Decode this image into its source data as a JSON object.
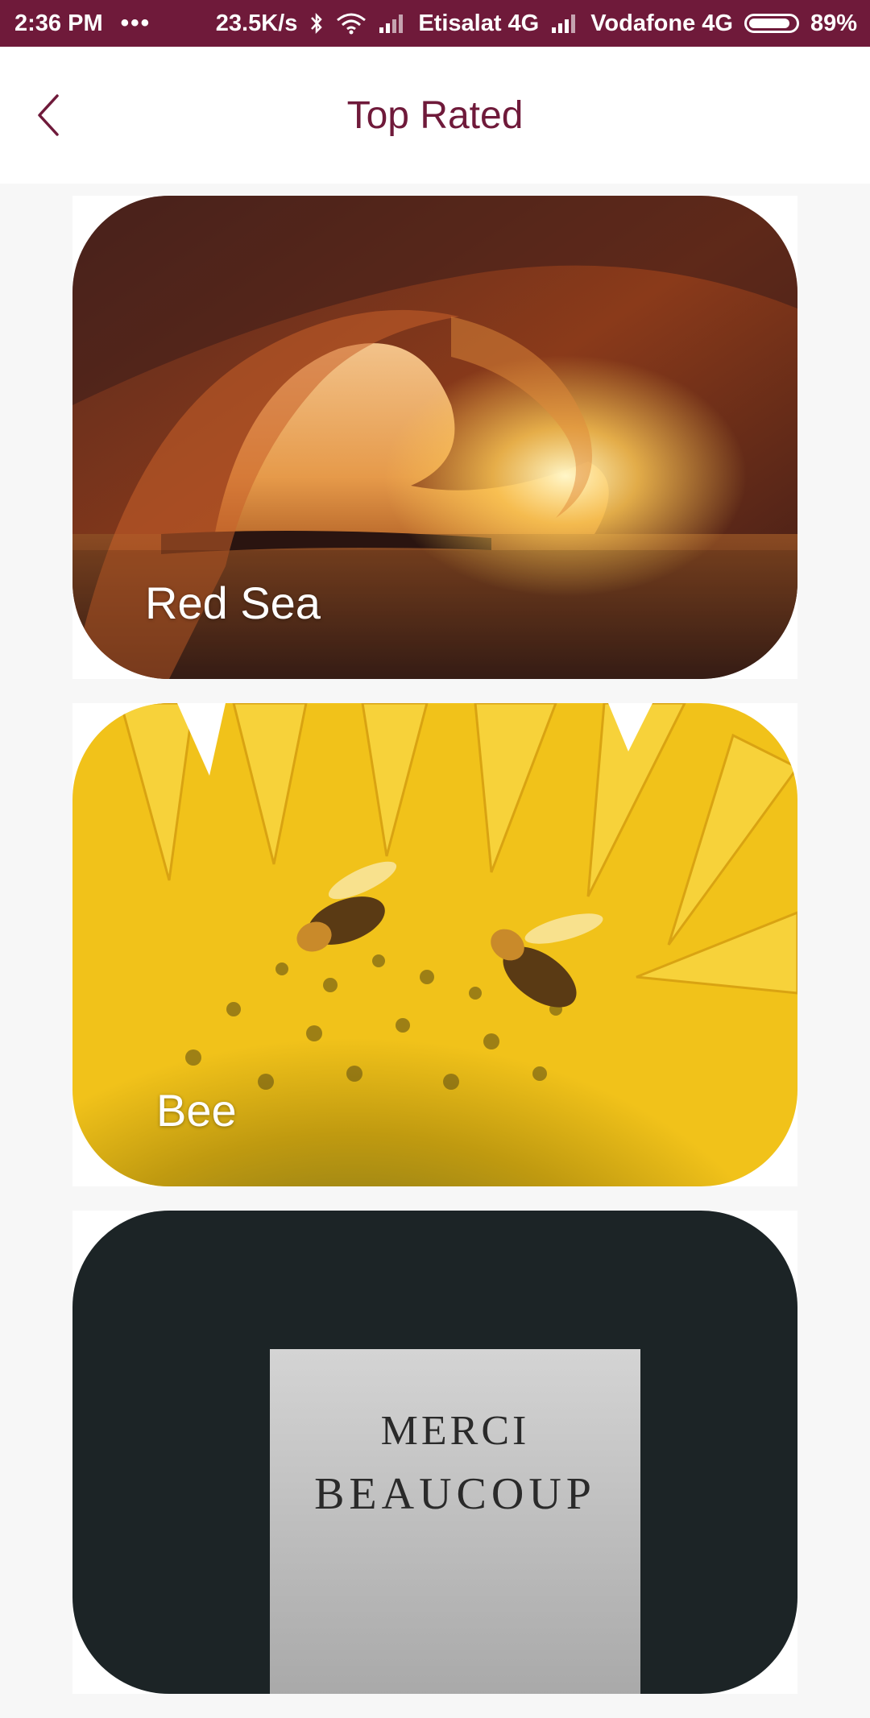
{
  "status_bar": {
    "time": "2:36 PM",
    "dots": "•••",
    "speed": "23.5K/s",
    "carrier1": "Etisalat 4G",
    "carrier2": "Vodafone 4G",
    "battery": "89%",
    "battery_level": 0.89
  },
  "app_bar": {
    "title": "Top Rated",
    "back_icon": "chevron-left-icon"
  },
  "cards": [
    {
      "label": "Red Sea",
      "image": "ocean-wave-sunset"
    },
    {
      "label": "Bee",
      "image": "bees-on-sunflower"
    },
    {
      "label": "",
      "image": "merci-beaucoup-card",
      "image_text": [
        "MERCI",
        "BEAUCOUP"
      ]
    }
  ],
  "colors": {
    "brand": "#6f1a3a",
    "background": "#f7f7f7",
    "surface": "#ffffff"
  }
}
